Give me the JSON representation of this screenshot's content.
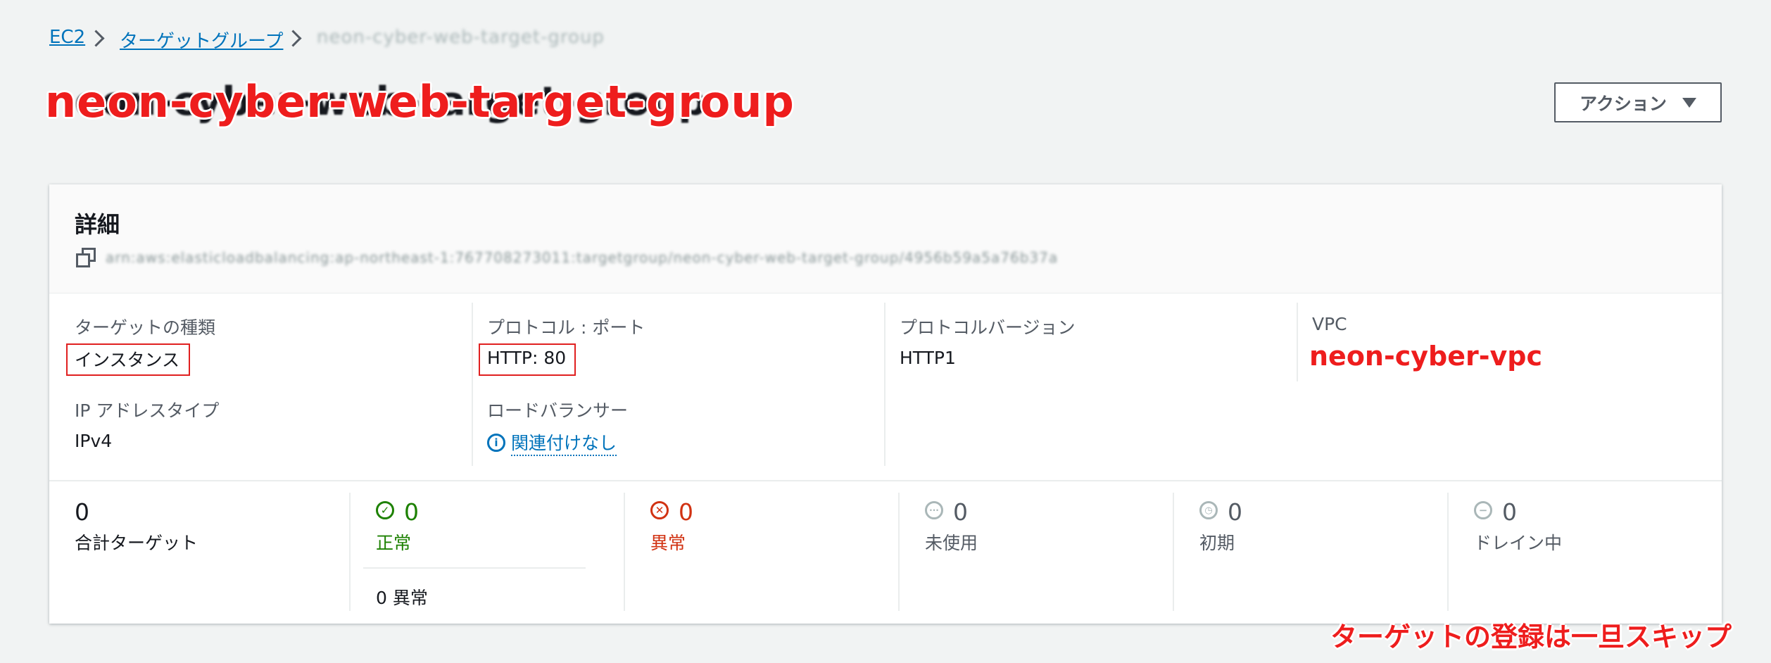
{
  "breadcrumb": {
    "items": [
      "EC2",
      "ターゲットグループ"
    ],
    "current_blurred": "neon-cyber-web-target-group"
  },
  "header": {
    "title_underlying": "neon-cyber-web-target-group",
    "title_annotation": "neon-cyber-web-target-group",
    "action_label": "アクション"
  },
  "details": {
    "heading": "詳細",
    "arn_blurred": "arn:aws:elasticloadbalancing:ap-northeast-1:767708273011:targetgroup/neon-cyber-web-target-group/4956b59a5a76b37a",
    "target_type": {
      "label": "ターゲットの種類",
      "value": "インスタンス"
    },
    "protocol_port": {
      "label": "プロトコル : ポート",
      "value": "HTTP: 80"
    },
    "protocol_version": {
      "label": "プロトコルバージョン",
      "value": "HTTP1"
    },
    "vpc": {
      "label": "VPC",
      "value_annotation": "neon-cyber-vpc"
    },
    "ip_type": {
      "label": "IP アドレスタイプ",
      "value": "IPv4"
    },
    "load_balancer": {
      "label": "ロードバランサー",
      "value": "関連付けなし"
    }
  },
  "stats": {
    "total": {
      "count": "0",
      "label": "合計ターゲット"
    },
    "healthy": {
      "count": "0",
      "label": "正常",
      "sub": "0 異常"
    },
    "unhealthy": {
      "count": "0",
      "label": "異常"
    },
    "unused": {
      "count": "0",
      "label": "未使用"
    },
    "initial": {
      "count": "0",
      "label": "初期"
    },
    "draining": {
      "count": "0",
      "label": "ドレイン中"
    }
  },
  "annotation_note": "ターゲットの登録は一旦スキップ",
  "colors": {
    "link": "#0073bb",
    "healthy": "#1d8102",
    "unhealthy": "#d13212",
    "muted": "#879596",
    "annotation": "#ee1d1d"
  }
}
